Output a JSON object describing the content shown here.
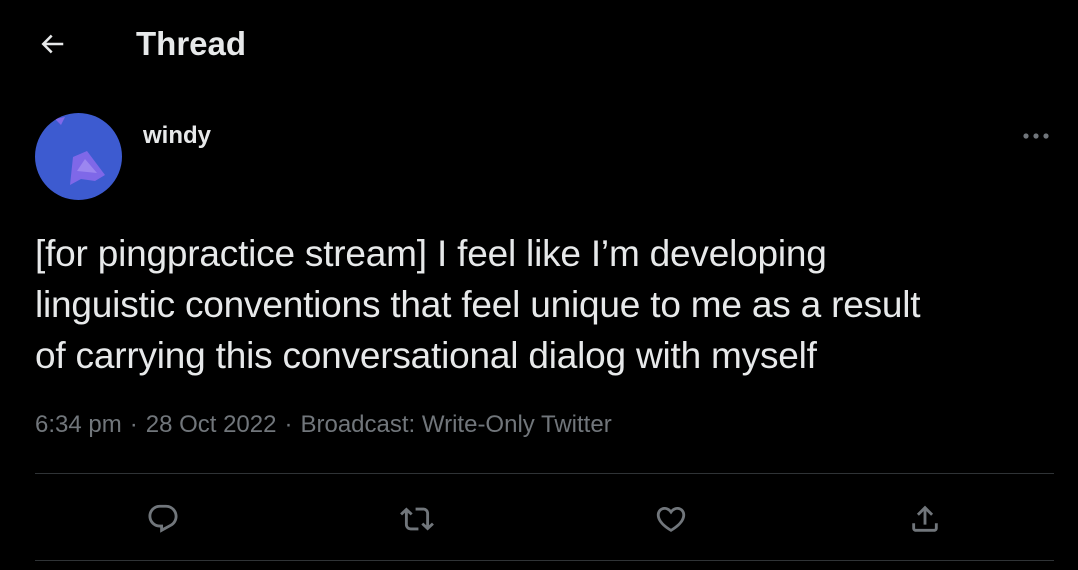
{
  "header": {
    "back_icon": "arrow-left-icon",
    "title": "Thread"
  },
  "tweet": {
    "author": {
      "display_name": "windy",
      "avatar_colors": {
        "background": "#3d5bd0",
        "accent": "#7f68e8"
      }
    },
    "more_icon": "more-horizontal-icon",
    "text": "[for pingpractice stream] I feel like I’m developing\nlinguistic conventions that feel unique to me as a result\nof carrying this conversational dialog with myself",
    "time": "6:34 pm",
    "date": "28 Oct 2022",
    "separator": "·",
    "source": "Broadcast: Write-Only Twitter",
    "actions": [
      {
        "name": "reply",
        "icon": "reply-icon"
      },
      {
        "name": "retweet",
        "icon": "retweet-icon"
      },
      {
        "name": "like",
        "icon": "heart-icon"
      },
      {
        "name": "share",
        "icon": "share-icon"
      }
    ]
  },
  "colors": {
    "background": "#000000",
    "text_primary": "#e7e9ea",
    "text_secondary": "#71767b",
    "divider": "#2f3336"
  }
}
